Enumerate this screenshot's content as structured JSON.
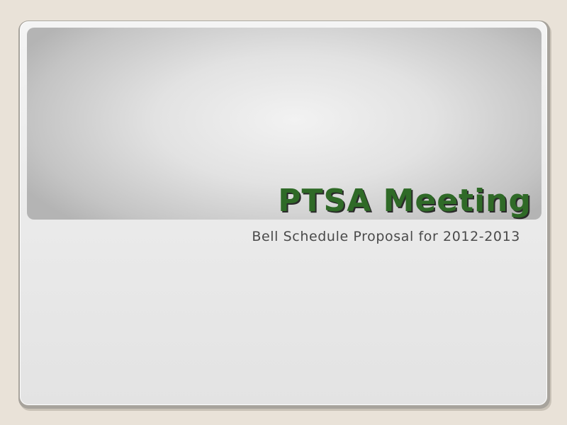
{
  "slide": {
    "title": "PTSA Meeting",
    "subtitle": "Bell Schedule Proposal for 2012-2013"
  },
  "colors": {
    "title": "#2f6a27",
    "subtitle": "#4a4a4a",
    "background": "#e9e2d8"
  }
}
